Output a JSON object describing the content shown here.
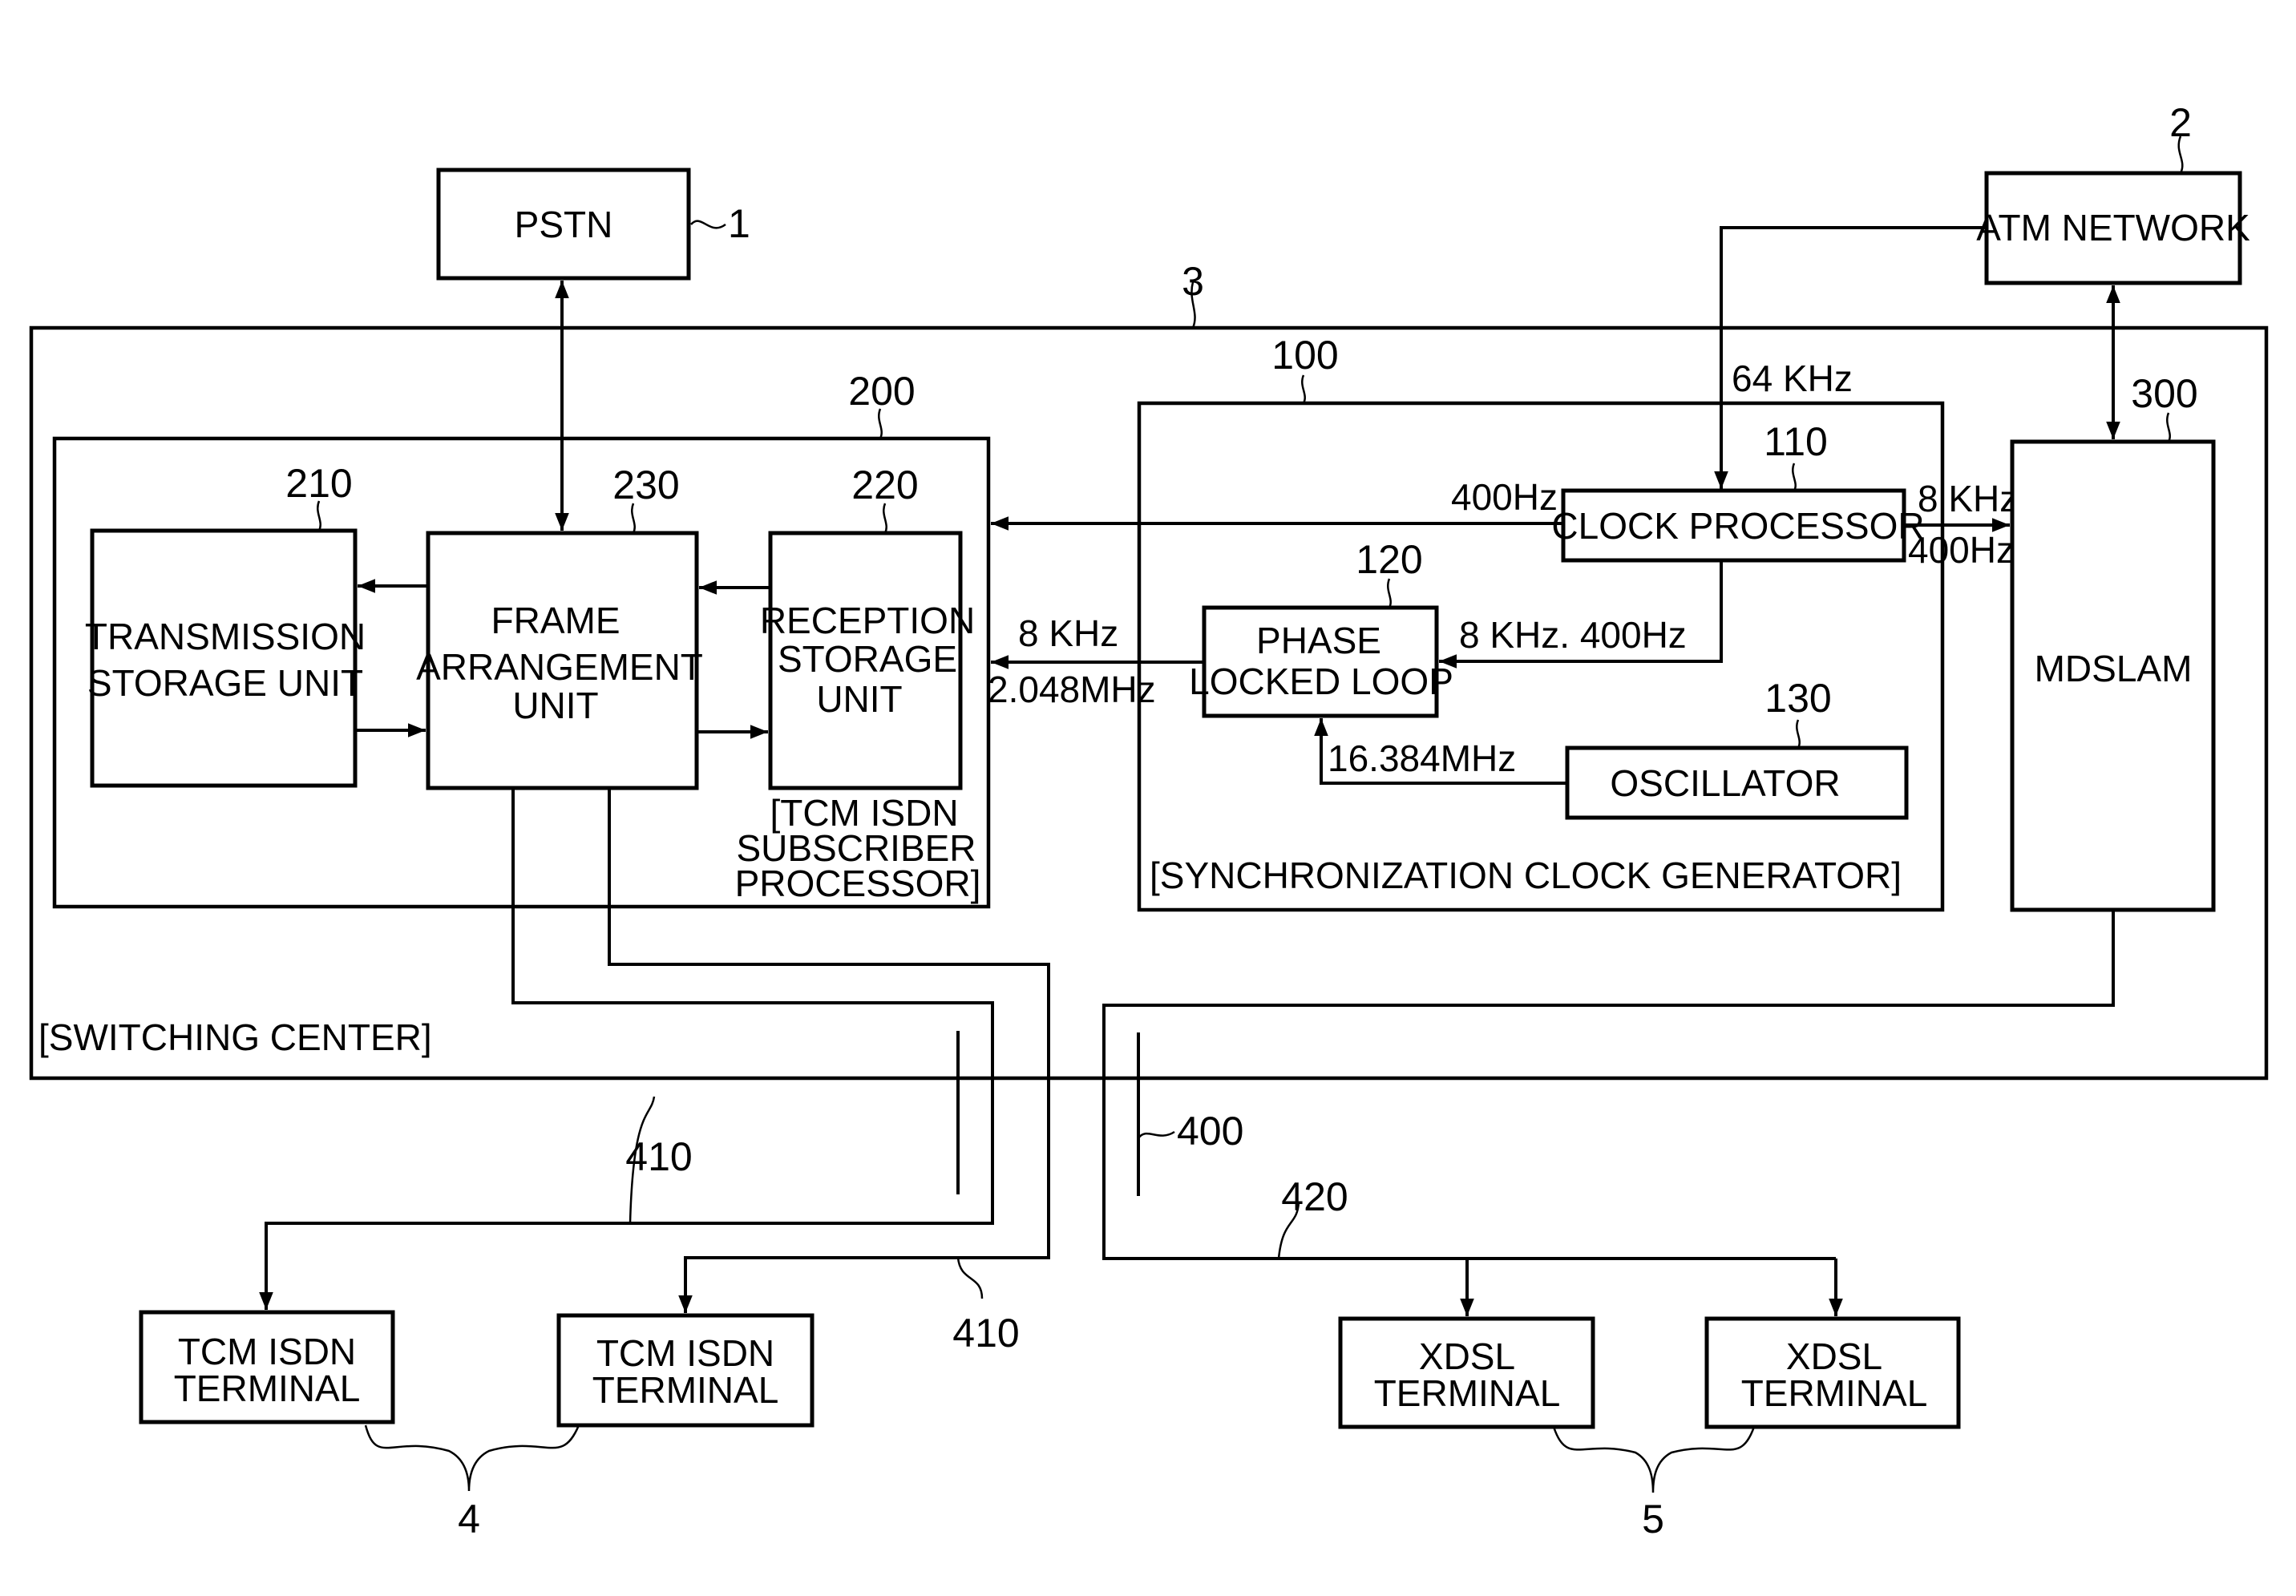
{
  "diagram": {
    "external": {
      "pstn": {
        "label": "PSTN",
        "ref": "1"
      },
      "atm": {
        "label": "ATM NETWORK",
        "ref": "2"
      }
    },
    "switching_center": {
      "ref": "3",
      "caption": "[SWITCHING CENTER]"
    },
    "subscriber_processor": {
      "ref": "200",
      "caption_lines": [
        "[TCM ISDN",
        "SUBSCRIBER",
        "PROCESSOR]"
      ],
      "transmission": {
        "ref": "210",
        "lines": [
          "TRANSMISSION",
          "STORAGE UNIT"
        ]
      },
      "frame": {
        "ref": "230",
        "lines": [
          "FRAME",
          "ARRANGEMENT",
          "UNIT"
        ]
      },
      "reception": {
        "ref": "220",
        "lines": [
          "RECEPTION",
          "STORAGE",
          "UNIT"
        ]
      }
    },
    "clock_generator": {
      "ref": "100",
      "caption": "[SYNCHRONIZATION CLOCK GENERATOR]",
      "clock_processor": {
        "ref": "110",
        "label": "CLOCK PROCESSOR"
      },
      "pll": {
        "ref": "120",
        "lines": [
          "PHASE",
          "LOCKED LOOP"
        ]
      },
      "oscillator": {
        "ref": "130",
        "label": "OSCILLATOR"
      }
    },
    "mdslam": {
      "ref": "300",
      "label": "MDSLAM"
    },
    "signals": {
      "atm_to_clock": "64 KHz",
      "clock_to_200": "400Hz",
      "clock_to_mdslam_top": "8 KHz",
      "clock_to_mdslam_bottom": "400Hz",
      "clock_to_pll": "8 KHz. 400Hz",
      "pll_to_200_top": "8 KHz",
      "pll_to_200_bottom": "2.048MHz",
      "osc_to_pll": "16.384MHz"
    },
    "lines": {
      "boundary_ref": "400",
      "tcm_line_ref_1": "410",
      "tcm_line_ref_2": "410",
      "xdsl_line_ref": "420"
    },
    "terminals": {
      "tcm": [
        {
          "lines": [
            "TCM ISDN",
            "TERMINAL"
          ]
        },
        {
          "lines": [
            "TCM ISDN",
            "TERMINAL"
          ]
        }
      ],
      "tcm_group_ref": "4",
      "xdsl": [
        {
          "lines": [
            "XDSL",
            "TERMINAL"
          ]
        },
        {
          "lines": [
            "XDSL",
            "TERMINAL"
          ]
        }
      ],
      "xdsl_group_ref": "5"
    }
  }
}
